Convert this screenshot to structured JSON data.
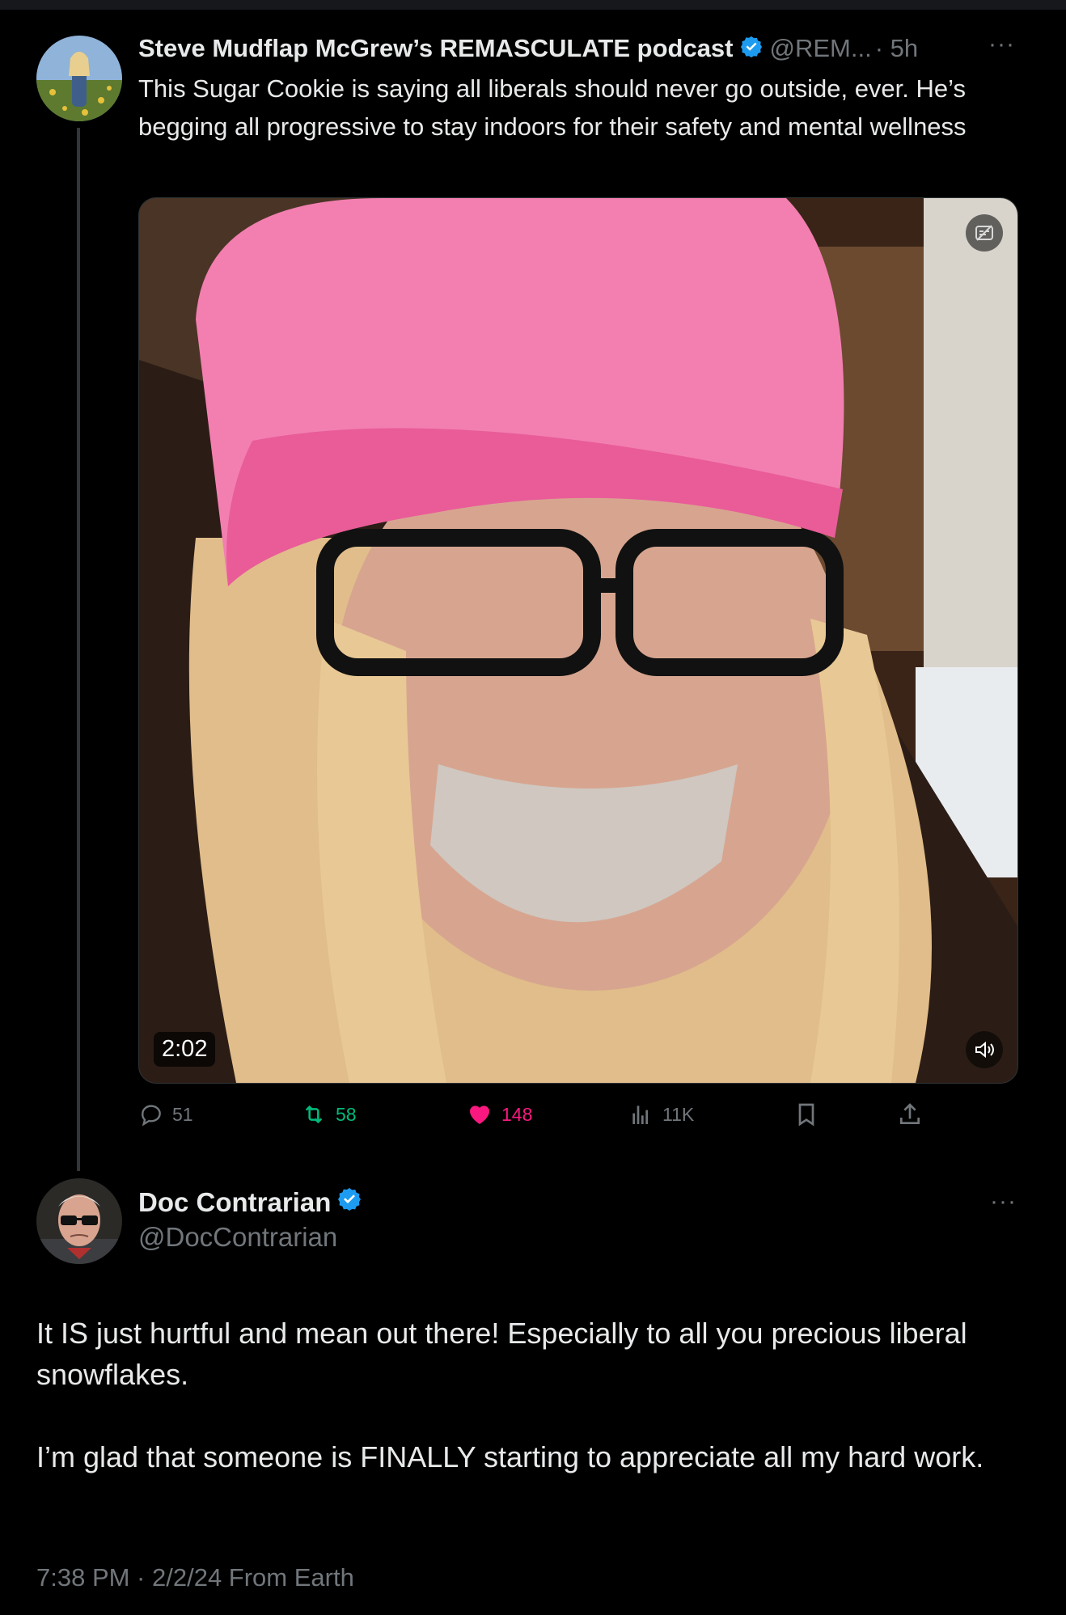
{
  "post": {
    "author_name": "Steve Mudflap McGrew’s REMASCULATE podcast",
    "handle": "@REM...",
    "time": "· 5h",
    "more": "···",
    "text": "This Sugar Cookie is saying all liberals should never go outside, ever. He’s begging all progressive to stay indoors for their safety and mental wellness",
    "video_duration": "2:02",
    "stats": {
      "replies": "51",
      "reposts": "58",
      "likes": "148",
      "views": "11K"
    }
  },
  "reply": {
    "author_name": "Doc Contrarian",
    "handle": "@DocContrarian",
    "more": "···",
    "text": "It IS just hurtful and mean out there! Especially to all you precious liberal snowflakes.\n\nI’m glad that someone is FINALLY starting to appreciate all my hard work.",
    "timestamp": "7:38 PM · 2/2/24 From Earth"
  },
  "colors": {
    "background": "#000000",
    "verified": "#1d9bf0",
    "repost": "#00ba7c",
    "like": "#f91880",
    "muted": "#71767b"
  },
  "icons": [
    "verified-badge-icon",
    "reply-icon",
    "repost-icon",
    "like-icon",
    "views-icon",
    "bookmark-icon",
    "share-icon",
    "volume-icon",
    "captions-icon",
    "more-icon"
  ]
}
